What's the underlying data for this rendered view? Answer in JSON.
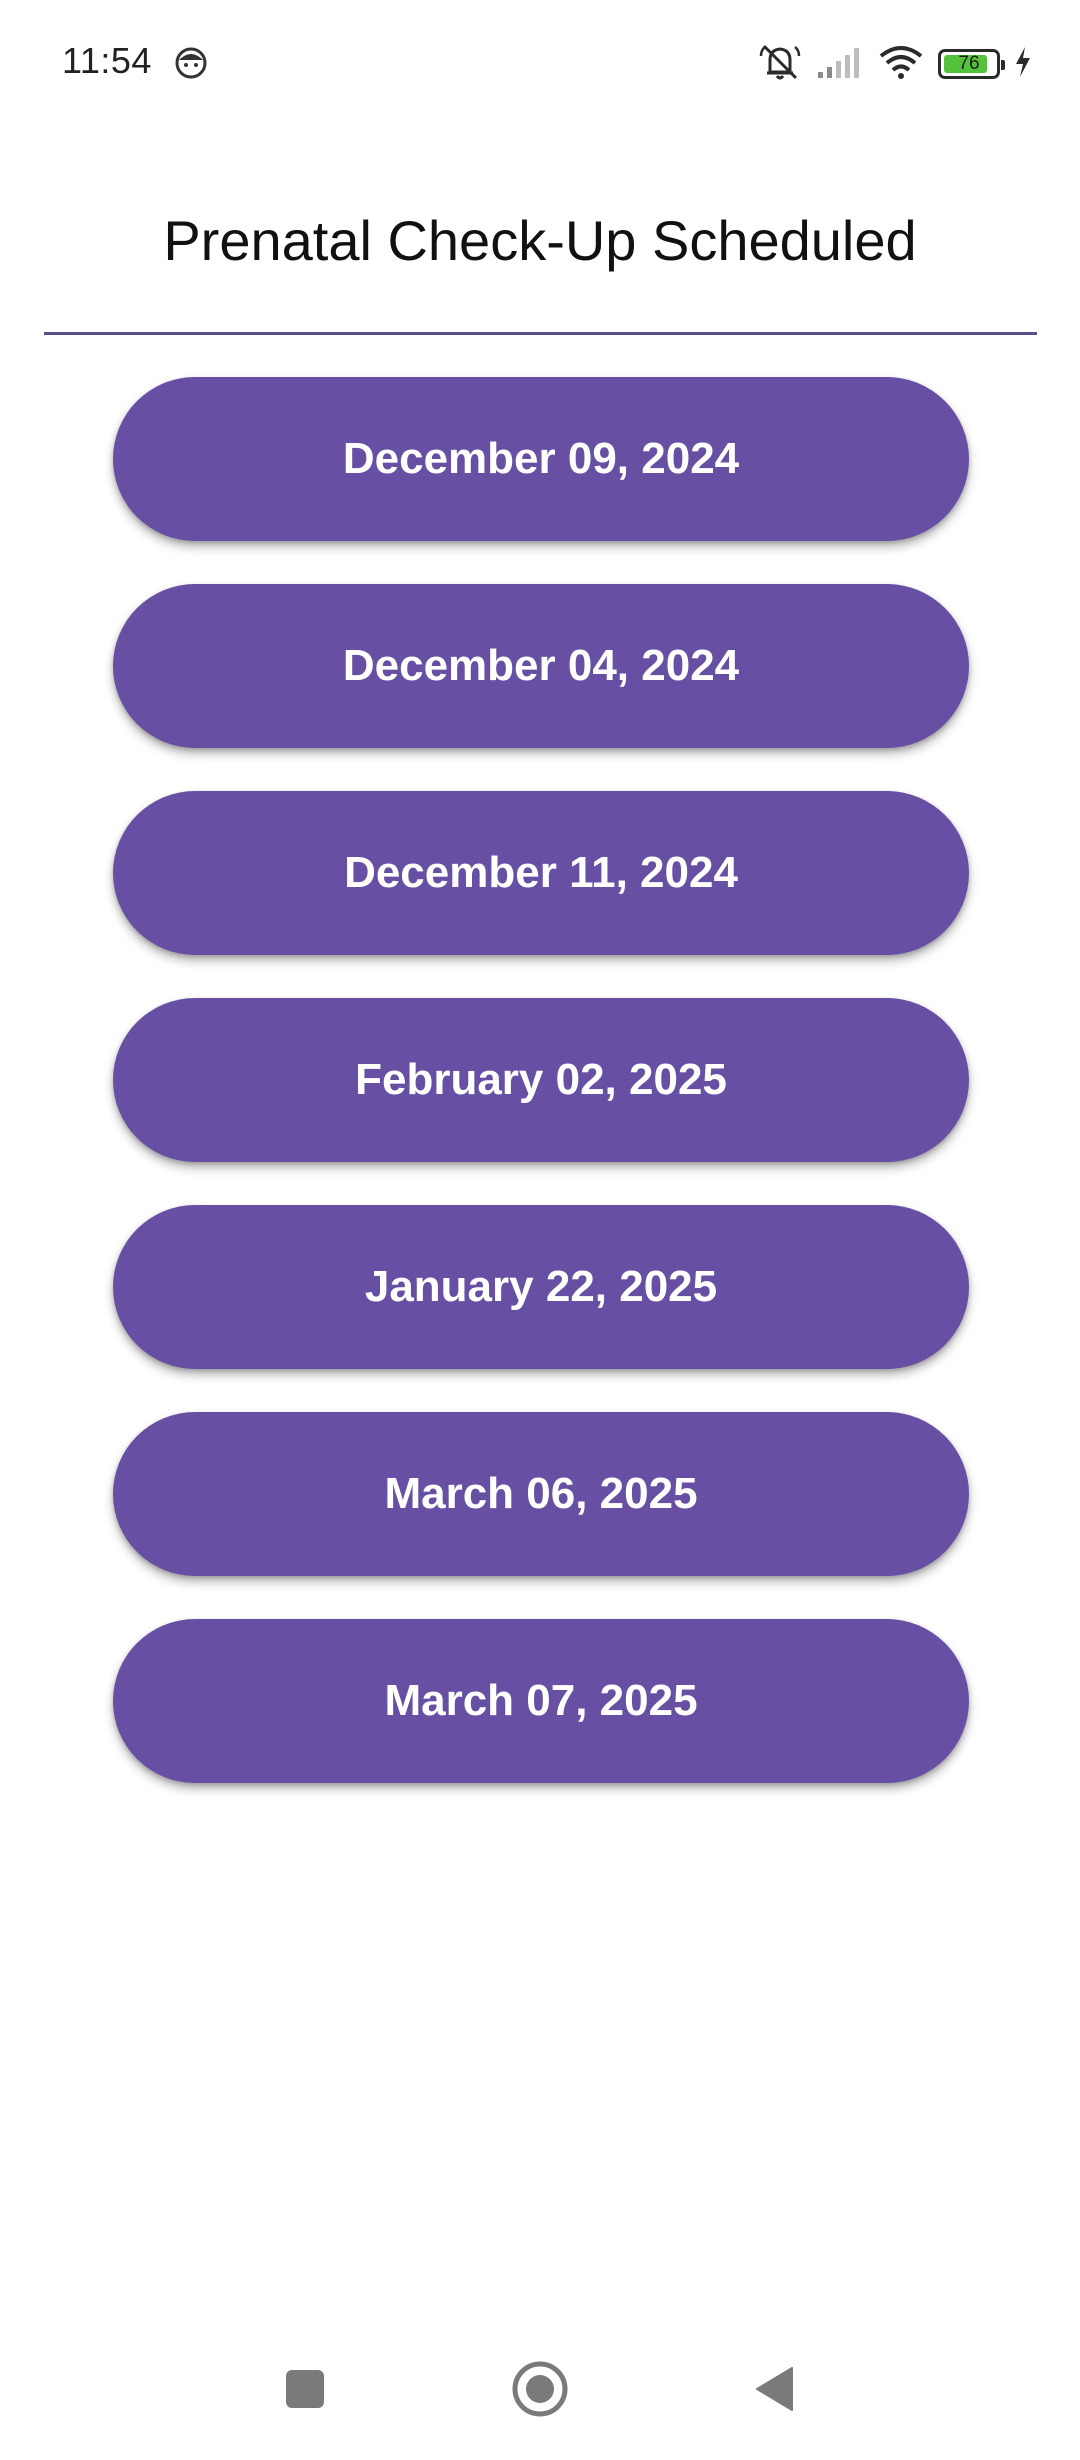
{
  "status_bar": {
    "time": "11:54",
    "battery_level": "76",
    "icons": [
      "face-icon",
      "mute-icon",
      "signal-icon",
      "wifi-icon",
      "battery-icon",
      "charging-icon"
    ]
  },
  "page": {
    "title": "Prenatal Check-Up Scheduled"
  },
  "dates": [
    "December 09, 2024",
    "December 04, 2024",
    "December 11, 2024",
    "February 02, 2025",
    "January 22, 2025",
    "March 06, 2025",
    "March 07, 2025"
  ],
  "colors": {
    "accent": "#6750a4",
    "divider": "#5a4f8a",
    "battery_fill": "#55c23b"
  },
  "nav": {
    "icons": [
      "recents-square-icon",
      "home-circle-icon",
      "back-triangle-icon"
    ]
  }
}
